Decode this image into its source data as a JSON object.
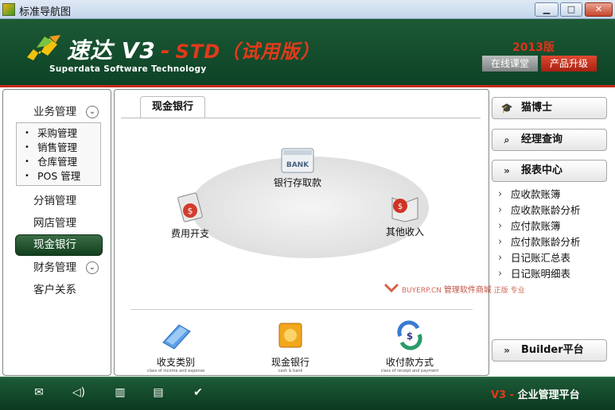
{
  "window": {
    "title": "标准导航图"
  },
  "header": {
    "brand": "速达",
    "version": "V3",
    "edition": "STD",
    "trial": "（试用版）",
    "company": "Superdata Software Technology",
    "year": "2013版",
    "online_course": "在线课堂",
    "upgrade": "产品升级"
  },
  "leftnav": {
    "business": "业务管理",
    "sub": [
      "采购管理",
      "销售管理",
      "仓库管理",
      "POS 管理"
    ],
    "distribution": "分销管理",
    "webstore": "网店管理",
    "cash_bank": "现金银行",
    "finance": "财务管理",
    "crm": "客户关系"
  },
  "main": {
    "tab": "现金银行",
    "bank_label": "BANK",
    "nodes": {
      "bank": "银行存取款",
      "expense": "费用开支",
      "other_income": "其他收入"
    },
    "watermark": {
      "site": "BUYERP.CN",
      "mall": "管理软件商城",
      "tag1": "正版",
      "tag2": "专业"
    },
    "quick": [
      {
        "label": "收支类别",
        "sub": "class of income and expense"
      },
      {
        "label": "现金银行",
        "sub": "cash & bank"
      },
      {
        "label": "收付款方式",
        "sub": "class of receipt and payment"
      }
    ]
  },
  "rightpanel": {
    "doctor": "猫博士",
    "manager_query": "经理查询",
    "report_center": "报表中心",
    "reports": [
      "应收款账簿",
      "应收款账龄分析",
      "应付款账簿",
      "应付款账龄分析",
      "日记账汇总表",
      "日记账明细表"
    ],
    "builder": "Builder平台"
  },
  "footer": {
    "v3": "V3",
    "dash": " - ",
    "platform": "企业管理平台"
  },
  "colors": {
    "header_bg": "#0d4226",
    "accent_red": "#e23a1a",
    "active_nav": "#123f1e"
  }
}
